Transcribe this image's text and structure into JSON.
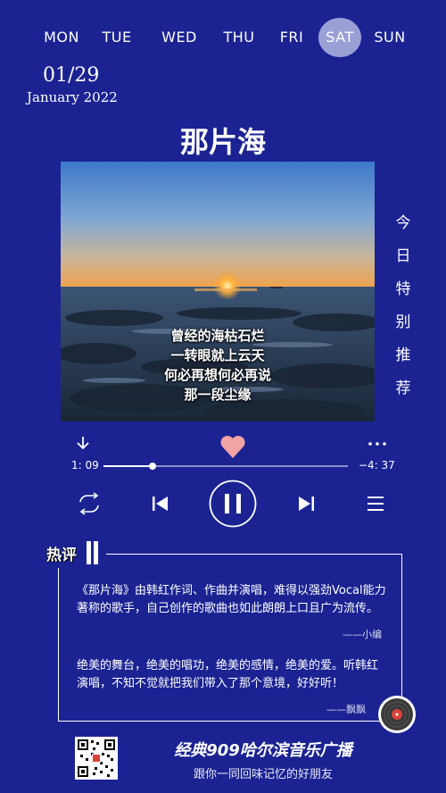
{
  "weekdays": [
    "MON",
    "TUE",
    "WED",
    "THU",
    "FRI",
    "SAT",
    "SUN"
  ],
  "active_day": "SAT",
  "date": {
    "day": "01/29",
    "month_year": "January 2022"
  },
  "song": {
    "title": "那片海",
    "lyrics": [
      "曾经的海枯石烂",
      "一转眼就上云天",
      "何必再想何必再说",
      "那一段尘缘"
    ]
  },
  "vertical_label": [
    "今",
    "日",
    "特",
    "别",
    "推",
    "荐"
  ],
  "player": {
    "elapsed": "1: 09",
    "remaining": "−4: 37",
    "progress": 0.2
  },
  "comments": {
    "label": "热评",
    "items": [
      {
        "text": "《那片海》由韩红作词、作曲并演唱，难得以强劲Vocal能力著称的歌手，自己创作的歌曲也如此朗朗上口且广为流传。",
        "author": "——小编"
      },
      {
        "text": "绝美的舞台，绝美的唱功，绝美的感情，绝美的爱。听韩红演唱，不知不觉就把我们带入了那个意境，好好听！",
        "author": "——飘飘"
      }
    ]
  },
  "footer": {
    "title": "经典909哈尔滨音乐广播",
    "subtitle": "跟你一同回味记忆的好朋友"
  },
  "icons": {
    "download": "download-icon",
    "heart": "heart-icon",
    "more": "more-icon",
    "repeat": "repeat-icon",
    "previous": "previous-icon",
    "pause": "pause-icon",
    "next": "next-icon",
    "playlist": "playlist-icon",
    "record": "vinyl-record-icon"
  },
  "colors": {
    "background": "#1b2393",
    "active_day": "#9aa0d6",
    "heart": "#f2a3a3",
    "record_red": "#d9443a"
  }
}
